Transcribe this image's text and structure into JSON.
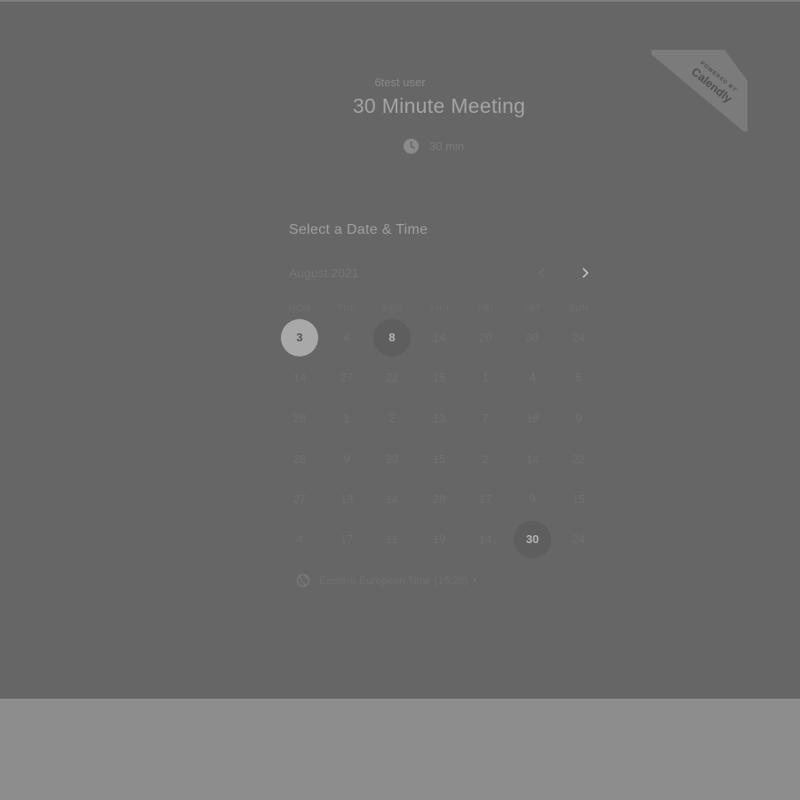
{
  "header": {
    "host_name": "6test user",
    "event_title": "30 Minute Meeting",
    "duration": "30 min"
  },
  "badge": {
    "line1": "POWERED BY",
    "line2": "Calendly"
  },
  "calendar": {
    "section_title": "Select a Date & Time",
    "month_label": "August 2021",
    "weekdays": [
      "MON",
      "TUE",
      "WED",
      "THU",
      "FRI",
      "SAT",
      "SUN"
    ],
    "rows": [
      [
        "3",
        "4",
        "8",
        "14",
        "20",
        "30",
        "24"
      ],
      [
        "14",
        "27",
        "22",
        "15",
        "1",
        "4",
        "5"
      ],
      [
        "28",
        "1",
        "2",
        "13",
        "7",
        "18",
        "9"
      ],
      [
        "28",
        "9",
        "20",
        "15",
        "2",
        "14",
        "22"
      ],
      [
        "27",
        "13",
        "14",
        "28",
        "17",
        "9",
        "15"
      ],
      [
        "4",
        "17",
        "11",
        "19",
        "14",
        "30",
        "24"
      ]
    ],
    "selected_day": "3",
    "available_days": [
      "8",
      "30"
    ]
  },
  "timezone": {
    "label": "Eastern European Time (16:28)"
  },
  "icons": {
    "duration": "clock-icon",
    "timezone": "globe-icon",
    "prev": "chevron-left-icon",
    "next": "chevron-right-icon"
  }
}
